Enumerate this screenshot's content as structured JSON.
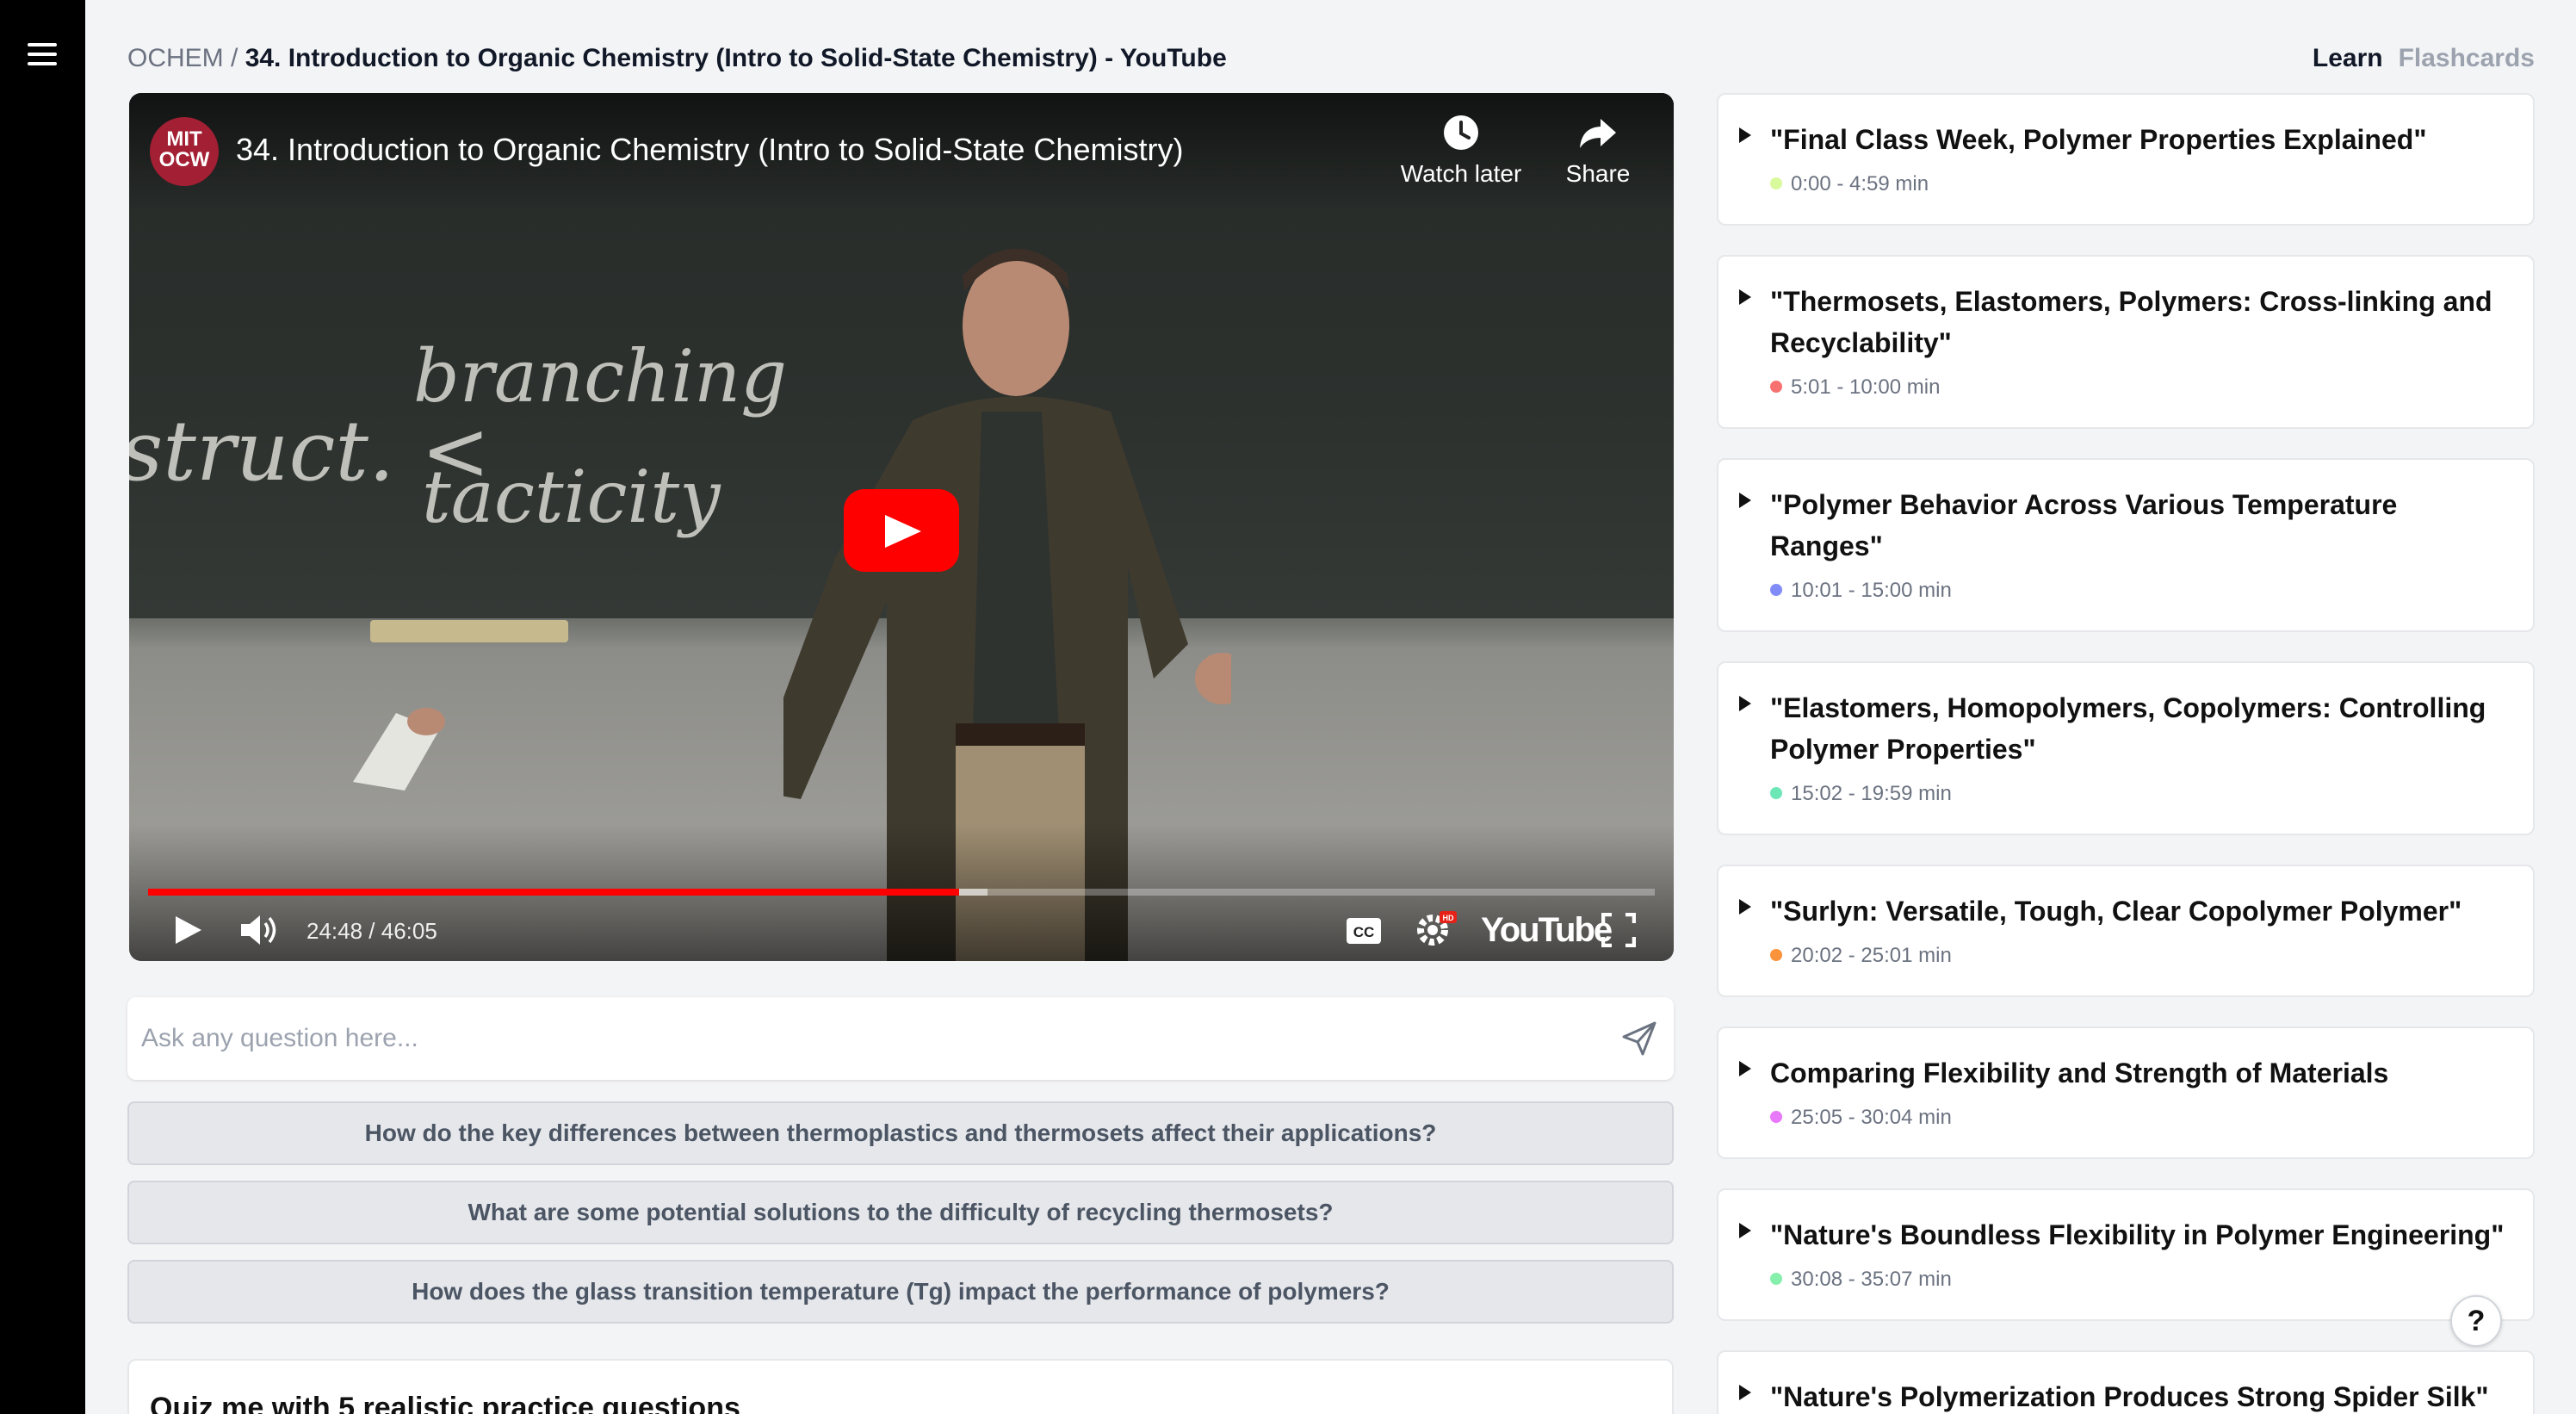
{
  "breadcrumb": {
    "parent": "OCHEM",
    "separator": " / ",
    "current": "34. Introduction to Organic Chemistry (Intro to Solid-State Chemistry) - YouTube"
  },
  "mode_tabs": {
    "learn": "Learn",
    "flashcards": "Flashcards"
  },
  "video": {
    "channel_logo": "MIT OCW",
    "title": "34. Introduction to Organic Chemistry (Intro to Solid-State Chemistry)",
    "watch_later": "Watch later",
    "share": "Share",
    "time_readout": "24:48 / 46:05",
    "progress_fraction": 0.538,
    "buffered_fraction": 0.557,
    "youtube_wordmark": "YouTube",
    "accent_color": "#ff0000"
  },
  "ask": {
    "placeholder": "Ask any question here..."
  },
  "suggestions": [
    "How do the key differences between thermoplastics and thermosets affect their applications?",
    "What are some potential solutions to the difficulty of recycling thermosets?",
    "How does the glass transition temperature (Tg) impact the performance of polymers?"
  ],
  "quiz": {
    "title": "Quiz me with 5 realistic practice questions"
  },
  "chapters": [
    {
      "title": "\"Final Class Week, Polymer Properties Explained\"",
      "time": "0:00 - 4:59 min",
      "color": "#d9f99d"
    },
    {
      "title": "\"Thermosets, Elastomers, Polymers: Cross-linking and Recyclability\"",
      "time": "5:01 - 10:00 min",
      "color": "#f87171"
    },
    {
      "title": "\"Polymer Behavior Across Various Temperature Ranges\"",
      "time": "10:01 - 15:00 min",
      "color": "#818cf8"
    },
    {
      "title": "\"Elastomers, Homopolymers, Copolymers: Controlling Polymer Properties\"",
      "time": "15:02 - 19:59 min",
      "color": "#6ee7b7"
    },
    {
      "title": "\"Surlyn: Versatile, Tough, Clear Copolymer Polymer\"",
      "time": "20:02 - 25:01 min",
      "color": "#fb923c"
    },
    {
      "title": "Comparing Flexibility and Strength of Materials",
      "time": "25:05 - 30:04 min",
      "color": "#e879f9"
    },
    {
      "title": "\"Nature's Boundless Flexibility in Polymer Engineering\"",
      "time": "30:08 - 35:07 min",
      "color": "#86efac"
    },
    {
      "title": "\"Nature's Polymerization Produces Strong Spider Silk\"",
      "time": "",
      "color": "#fde68a"
    }
  ],
  "help": {
    "label": "?"
  }
}
